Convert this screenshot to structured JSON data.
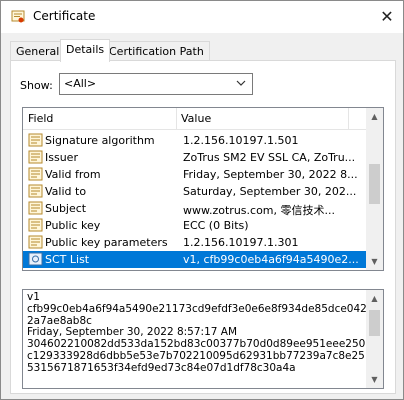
{
  "window": {
    "title": "Certificate",
    "close_glyph": "✕"
  },
  "tabs": [
    {
      "label": "General",
      "active": false
    },
    {
      "label": "Details",
      "active": true
    },
    {
      "label": "Certification Path",
      "active": false
    }
  ],
  "show": {
    "label": "Show:",
    "selected": "<All>"
  },
  "list": {
    "columns": {
      "field": "Field",
      "value": "Value"
    },
    "rows": [
      {
        "field": "Signature algorithm",
        "value": "1.2.156.10197.1.501",
        "icon": "certificate-field-icon"
      },
      {
        "field": "Issuer",
        "value": "ZoTrus SM2 EV SSL CA, ZoTru...",
        "icon": "certificate-field-icon"
      },
      {
        "field": "Valid from",
        "value": "Friday, September 30, 2022 8...",
        "icon": "certificate-field-icon"
      },
      {
        "field": "Valid to",
        "value": "Saturday, September 30, 202...",
        "icon": "certificate-field-icon"
      },
      {
        "field": "Subject",
        "value": "www.zotrus.com, 零信技术...",
        "icon": "certificate-field-icon"
      },
      {
        "field": "Public key",
        "value": "ECC (0 Bits)",
        "icon": "certificate-field-icon"
      },
      {
        "field": "Public key parameters",
        "value": "1.2.156.10197.1.301",
        "icon": "certificate-field-icon"
      },
      {
        "field": "SCT List",
        "value": "v1, cfb99c0eb4a6f94a5490e2...",
        "icon": "sct-extension-icon",
        "selected": true
      }
    ]
  },
  "detail": {
    "lines": [
      "v1",
      "cfb99c0eb4a6f94a5490e21173cd9efdf3e0e6e8f934de85dce0422a7ae8ab8c",
      "Friday, September 30, 2022 8:57:17 AM",
      "30460221008​2dd533da152bd83c00377b70d0d89ee951eee250c129333928d6dbb5e53e7b702210095d62931bb77239a7c8e255315671871653f34efd9ed73c84e07d1df78c30a4a"
    ]
  },
  "colors": {
    "selection": "#0078d7",
    "panel_border": "#d9d9d9"
  }
}
